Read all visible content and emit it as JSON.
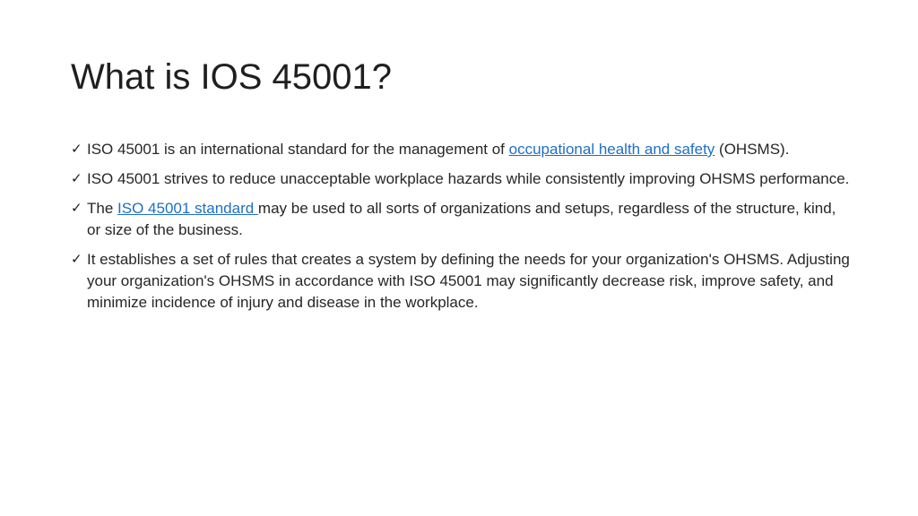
{
  "slide": {
    "title": "What is IOS 45001?",
    "bullet_icon": "check-mark-icon",
    "link_color": "#1f6fc5",
    "bullets": [
      {
        "pre": "ISO 45001 is an international standard for the management of ",
        "link": "occupational health and safety",
        "post": " (OHSMS)."
      },
      {
        "text": " ISO 45001 strives to reduce unacceptable workplace hazards while consistently improving OHSMS performance."
      },
      {
        "pre": " The ",
        "link": "ISO 45001 standard ",
        "post": "may be used to all sorts of organizations and setups, regardless of the structure, kind, or size of the business."
      },
      {
        "text": "It establishes a set of rules that creates a system by defining the needs for your organization's OHSMS. Adjusting your organization's OHSMS in accordance with ISO 45001 may significantly decrease risk, improve safety, and minimize incidence of injury and disease in the workplace."
      }
    ]
  }
}
